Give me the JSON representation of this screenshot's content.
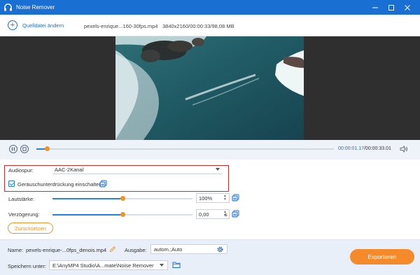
{
  "window": {
    "title": "Noise Remover"
  },
  "toolbar": {
    "add_source_label": "Quelldatei ändern",
    "file_name": "pexels-enrique...160-30fps.mp4",
    "file_meta": "3840x2160/00:00:33/98,08 MB"
  },
  "player": {
    "current_time": "00:00:01.17",
    "total_time": "/00:00:33.01",
    "progress": 0.035
  },
  "audio": {
    "track_label": "Audiospur:",
    "track_value": "AAC-2Kanal",
    "noise_reduction_label": "Geräuschunterdrückung einschalten",
    "noise_reduction_checked": true,
    "volume_label": "Lautstärke:",
    "volume_value": "100%",
    "volume_level": 0.5,
    "delay_label": "Verzögerung:",
    "delay_value": "0,00",
    "delay_unit": "s",
    "delay_level": 0.5,
    "reset_label": "Zurücksetzen"
  },
  "output": {
    "name_label": "Name:",
    "name_value": "pexels-enrique-...0fps_denois.mp4",
    "format_label": "Ausgabe:",
    "format_value": "autom.;Auto",
    "save_label": "Speichern unter:",
    "save_path": "E:\\AnyMP4 Studio\\A...mate\\Noise Remover",
    "export_label": "Exportieren"
  },
  "icons": {
    "app": "headphones-icon",
    "add": "plus-circle-icon",
    "pause": "pause-icon",
    "stop": "stop-icon",
    "volume": "speaker-icon",
    "copy": "copy-settings-icon",
    "edit": "pencil-icon",
    "settings": "gear-icon",
    "folder": "folder-icon"
  },
  "colors": {
    "titlebar": "#1a6fd2",
    "accent": "#2580e8",
    "orange": "#f39324",
    "highlight_border": "#d12c2c"
  }
}
